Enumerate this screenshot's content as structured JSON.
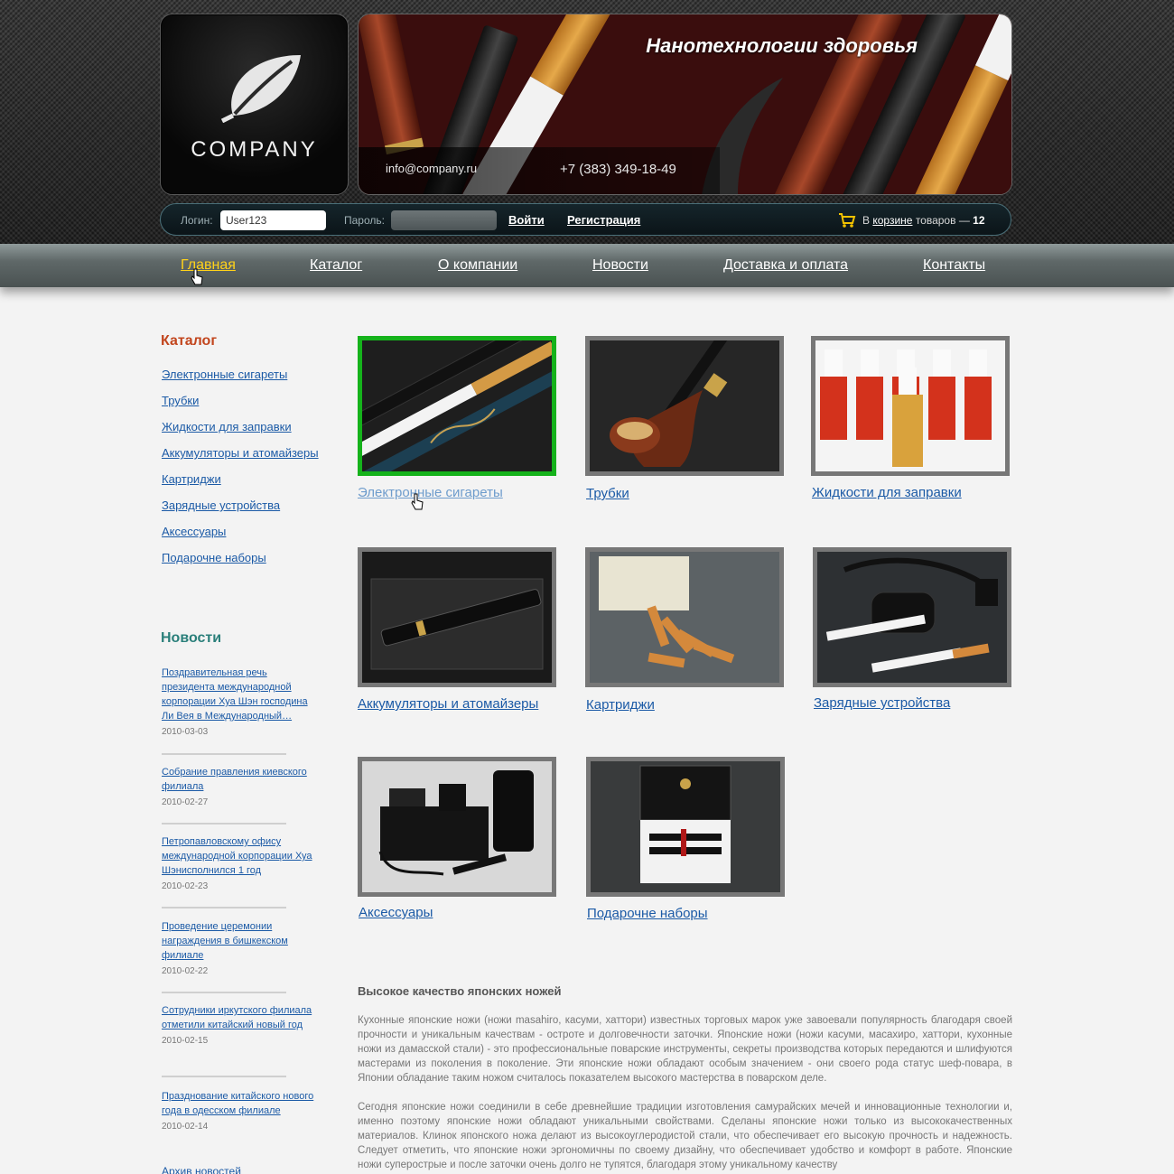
{
  "header": {
    "logo_text": "COMPANY",
    "banner_title": "Нанотехнологии здоровья",
    "email": "info@company.ru",
    "phone": "+7 (383) 349-18-49"
  },
  "login_bar": {
    "login_label": "Логин:",
    "login_value": "User123",
    "password_label": "Пароль:",
    "login_button": "Войти",
    "register_link": "Регистрация",
    "cart_prefix": "В",
    "cart_link": "корзине",
    "cart_suffix": "товаров —",
    "cart_count": "12"
  },
  "menu": {
    "items": [
      {
        "label": "Главная",
        "active": true
      },
      {
        "label": "Каталог"
      },
      {
        "label": "О компании"
      },
      {
        "label": "Новости"
      },
      {
        "label": "Доставка и оплата"
      },
      {
        "label": "Контакты"
      }
    ]
  },
  "sidebar": {
    "catalog_title": "Каталог",
    "catalog_items": [
      "Электронные сигареты",
      "Трубки",
      "Жидкости для заправки",
      "Аккумуляторы и атомайзеры",
      "Картриджи",
      "Зарядные устройства",
      "Аксессуары",
      "Подарочне наборы"
    ],
    "news_title": "Новости",
    "news": [
      {
        "title": "Поздравительная речь президента международной корпорации Хуа Шэн господина Ли Вея в Международный…",
        "date": "2010-03-03"
      },
      {
        "title": "Собрание правления киевского филиала",
        "date": "2010-02-27"
      },
      {
        "title": "Петропавловскому офису международной корпорации Хуа Шэнисполнился 1 год",
        "date": "2010-02-23"
      },
      {
        "title": "Проведение церемонии награждения в бишкекском филиале",
        "date": "2010-02-22"
      },
      {
        "title": "Сотрудники иркутского филиала отметили китайский новый год",
        "date": "2010-02-15"
      },
      {
        "title": "Празднование китайского нового года в одесском филиале",
        "date": "2010-02-14"
      }
    ],
    "news_archive": "Архив новостей"
  },
  "products": [
    {
      "label": "Электронные сигареты",
      "image": "e-cigarettes-photo",
      "selected": true
    },
    {
      "label": "Трубки",
      "image": "pipe-photo"
    },
    {
      "label": "Жидкости для заправки",
      "image": "liquid-bottles-photo"
    },
    {
      "label": "Аккумуляторы и атомайзеры",
      "image": "battery-photo"
    },
    {
      "label": "Картриджи",
      "image": "cartridges-photo"
    },
    {
      "label": "Зарядные устройства",
      "image": "charger-photo"
    },
    {
      "label": "Аксессуары",
      "image": "accessories-photo"
    },
    {
      "label": "Подарочне наборы",
      "image": "gift-set-photo"
    }
  ],
  "article": {
    "title": "Высокое качество японских ножей",
    "p1": "Кухонные японские ножи (ножи masahiro, касуми, хаттори) известных торговых марок уже завоевали популярность благодаря своей прочности и уникальным качествам - остроте и долговечности заточки. Японские ножи (ножи касуми, масахиро, хаттори, кухонные ножи из дамасской стали) - это профессиональные поварские инструменты, секреты производства которых передаются и шлифуются мастерами из поколения в поколение. Эти японские ножи обладают особым значением - они своего рода статус шеф-повара, в Японии обладание таким ножом считалось показателем высокого мастерства в поварском деле.",
    "p2": "Сегодня японские ножи соединили в себе древнейшие традиции изготовления самурайских мечей и инновационные технологии и, именно поэтому японские ножи обладают уникальными свойствами. Сделаны японские ножи только из высококачественных материалов. Клинок японского ножа делают из высокоуглеродистой стали, что обеспечивает его высокую прочность и надежность. Следует отметить, что японские ножи эргономичны по своему дизайну, что обеспечивает удобство и комфорт в работе. Японские ножи суперострые и после заточки очень долго не тупятся, благодаря этому уникальному качеству"
  },
  "colors": {
    "link": "#1b5aa6",
    "menu_active": "#ffd21a",
    "catalog_heading": "#c2461e",
    "news_heading": "#2a7f7a",
    "selected_border": "#15b21b"
  }
}
